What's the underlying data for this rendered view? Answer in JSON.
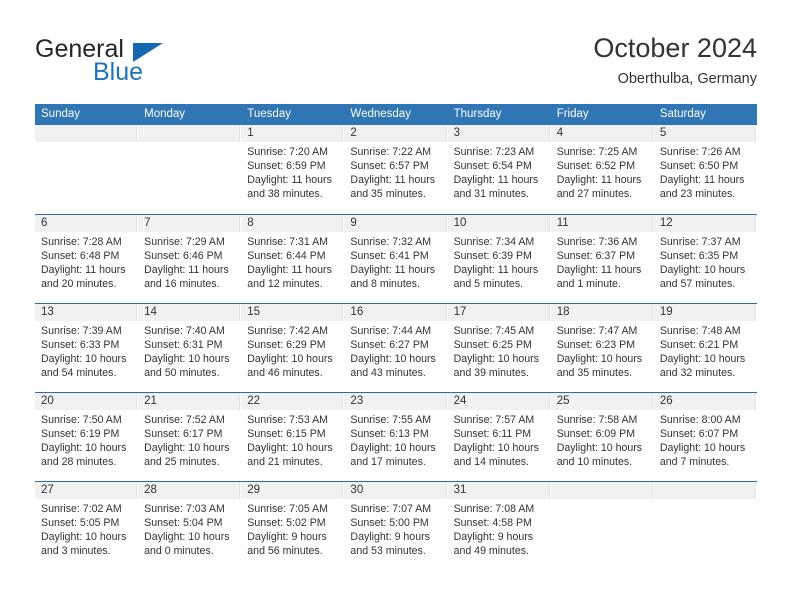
{
  "brand": {
    "name_part1": "General",
    "name_part2": "Blue",
    "triangle_color": "#1567b2",
    "blue_color": "#1d74bd"
  },
  "header": {
    "title": "October 2024",
    "subtitle": "Oberthulba, Germany"
  },
  "colors": {
    "header_blue": "#3075b4",
    "week_divider": "#2e6da4",
    "day_band_gray": "#f1f1f1",
    "text": "#333333"
  },
  "calendar": {
    "weekday_headers": [
      "Sunday",
      "Monday",
      "Tuesday",
      "Wednesday",
      "Thursday",
      "Friday",
      "Saturday"
    ],
    "weeks": [
      [
        {
          "day": "",
          "sunrise": "",
          "sunset": "",
          "daylight1": "",
          "daylight2": "",
          "empty": true
        },
        {
          "day": "",
          "sunrise": "",
          "sunset": "",
          "daylight1": "",
          "daylight2": "",
          "empty": true
        },
        {
          "day": "1",
          "sunrise": "Sunrise: 7:20 AM",
          "sunset": "Sunset: 6:59 PM",
          "daylight1": "Daylight: 11 hours",
          "daylight2": "and 38 minutes."
        },
        {
          "day": "2",
          "sunrise": "Sunrise: 7:22 AM",
          "sunset": "Sunset: 6:57 PM",
          "daylight1": "Daylight: 11 hours",
          "daylight2": "and 35 minutes."
        },
        {
          "day": "3",
          "sunrise": "Sunrise: 7:23 AM",
          "sunset": "Sunset: 6:54 PM",
          "daylight1": "Daylight: 11 hours",
          "daylight2": "and 31 minutes."
        },
        {
          "day": "4",
          "sunrise": "Sunrise: 7:25 AM",
          "sunset": "Sunset: 6:52 PM",
          "daylight1": "Daylight: 11 hours",
          "daylight2": "and 27 minutes."
        },
        {
          "day": "5",
          "sunrise": "Sunrise: 7:26 AM",
          "sunset": "Sunset: 6:50 PM",
          "daylight1": "Daylight: 11 hours",
          "daylight2": "and 23 minutes."
        }
      ],
      [
        {
          "day": "6",
          "sunrise": "Sunrise: 7:28 AM",
          "sunset": "Sunset: 6:48 PM",
          "daylight1": "Daylight: 11 hours",
          "daylight2": "and 20 minutes."
        },
        {
          "day": "7",
          "sunrise": "Sunrise: 7:29 AM",
          "sunset": "Sunset: 6:46 PM",
          "daylight1": "Daylight: 11 hours",
          "daylight2": "and 16 minutes."
        },
        {
          "day": "8",
          "sunrise": "Sunrise: 7:31 AM",
          "sunset": "Sunset: 6:44 PM",
          "daylight1": "Daylight: 11 hours",
          "daylight2": "and 12 minutes."
        },
        {
          "day": "9",
          "sunrise": "Sunrise: 7:32 AM",
          "sunset": "Sunset: 6:41 PM",
          "daylight1": "Daylight: 11 hours",
          "daylight2": "and 8 minutes."
        },
        {
          "day": "10",
          "sunrise": "Sunrise: 7:34 AM",
          "sunset": "Sunset: 6:39 PM",
          "daylight1": "Daylight: 11 hours",
          "daylight2": "and 5 minutes."
        },
        {
          "day": "11",
          "sunrise": "Sunrise: 7:36 AM",
          "sunset": "Sunset: 6:37 PM",
          "daylight1": "Daylight: 11 hours",
          "daylight2": "and 1 minute."
        },
        {
          "day": "12",
          "sunrise": "Sunrise: 7:37 AM",
          "sunset": "Sunset: 6:35 PM",
          "daylight1": "Daylight: 10 hours",
          "daylight2": "and 57 minutes."
        }
      ],
      [
        {
          "day": "13",
          "sunrise": "Sunrise: 7:39 AM",
          "sunset": "Sunset: 6:33 PM",
          "daylight1": "Daylight: 10 hours",
          "daylight2": "and 54 minutes."
        },
        {
          "day": "14",
          "sunrise": "Sunrise: 7:40 AM",
          "sunset": "Sunset: 6:31 PM",
          "daylight1": "Daylight: 10 hours",
          "daylight2": "and 50 minutes."
        },
        {
          "day": "15",
          "sunrise": "Sunrise: 7:42 AM",
          "sunset": "Sunset: 6:29 PM",
          "daylight1": "Daylight: 10 hours",
          "daylight2": "and 46 minutes."
        },
        {
          "day": "16",
          "sunrise": "Sunrise: 7:44 AM",
          "sunset": "Sunset: 6:27 PM",
          "daylight1": "Daylight: 10 hours",
          "daylight2": "and 43 minutes."
        },
        {
          "day": "17",
          "sunrise": "Sunrise: 7:45 AM",
          "sunset": "Sunset: 6:25 PM",
          "daylight1": "Daylight: 10 hours",
          "daylight2": "and 39 minutes."
        },
        {
          "day": "18",
          "sunrise": "Sunrise: 7:47 AM",
          "sunset": "Sunset: 6:23 PM",
          "daylight1": "Daylight: 10 hours",
          "daylight2": "and 35 minutes."
        },
        {
          "day": "19",
          "sunrise": "Sunrise: 7:48 AM",
          "sunset": "Sunset: 6:21 PM",
          "daylight1": "Daylight: 10 hours",
          "daylight2": "and 32 minutes."
        }
      ],
      [
        {
          "day": "20",
          "sunrise": "Sunrise: 7:50 AM",
          "sunset": "Sunset: 6:19 PM",
          "daylight1": "Daylight: 10 hours",
          "daylight2": "and 28 minutes."
        },
        {
          "day": "21",
          "sunrise": "Sunrise: 7:52 AM",
          "sunset": "Sunset: 6:17 PM",
          "daylight1": "Daylight: 10 hours",
          "daylight2": "and 25 minutes."
        },
        {
          "day": "22",
          "sunrise": "Sunrise: 7:53 AM",
          "sunset": "Sunset: 6:15 PM",
          "daylight1": "Daylight: 10 hours",
          "daylight2": "and 21 minutes."
        },
        {
          "day": "23",
          "sunrise": "Sunrise: 7:55 AM",
          "sunset": "Sunset: 6:13 PM",
          "daylight1": "Daylight: 10 hours",
          "daylight2": "and 17 minutes."
        },
        {
          "day": "24",
          "sunrise": "Sunrise: 7:57 AM",
          "sunset": "Sunset: 6:11 PM",
          "daylight1": "Daylight: 10 hours",
          "daylight2": "and 14 minutes."
        },
        {
          "day": "25",
          "sunrise": "Sunrise: 7:58 AM",
          "sunset": "Sunset: 6:09 PM",
          "daylight1": "Daylight: 10 hours",
          "daylight2": "and 10 minutes."
        },
        {
          "day": "26",
          "sunrise": "Sunrise: 8:00 AM",
          "sunset": "Sunset: 6:07 PM",
          "daylight1": "Daylight: 10 hours",
          "daylight2": "and 7 minutes."
        }
      ],
      [
        {
          "day": "27",
          "sunrise": "Sunrise: 7:02 AM",
          "sunset": "Sunset: 5:05 PM",
          "daylight1": "Daylight: 10 hours",
          "daylight2": "and 3 minutes."
        },
        {
          "day": "28",
          "sunrise": "Sunrise: 7:03 AM",
          "sunset": "Sunset: 5:04 PM",
          "daylight1": "Daylight: 10 hours",
          "daylight2": "and 0 minutes."
        },
        {
          "day": "29",
          "sunrise": "Sunrise: 7:05 AM",
          "sunset": "Sunset: 5:02 PM",
          "daylight1": "Daylight: 9 hours",
          "daylight2": "and 56 minutes."
        },
        {
          "day": "30",
          "sunrise": "Sunrise: 7:07 AM",
          "sunset": "Sunset: 5:00 PM",
          "daylight1": "Daylight: 9 hours",
          "daylight2": "and 53 minutes."
        },
        {
          "day": "31",
          "sunrise": "Sunrise: 7:08 AM",
          "sunset": "Sunset: 4:58 PM",
          "daylight1": "Daylight: 9 hours",
          "daylight2": "and 49 minutes."
        },
        {
          "day": "",
          "sunrise": "",
          "sunset": "",
          "daylight1": "",
          "daylight2": "",
          "empty": true
        },
        {
          "day": "",
          "sunrise": "",
          "sunset": "",
          "daylight1": "",
          "daylight2": "",
          "empty": true
        }
      ]
    ]
  }
}
